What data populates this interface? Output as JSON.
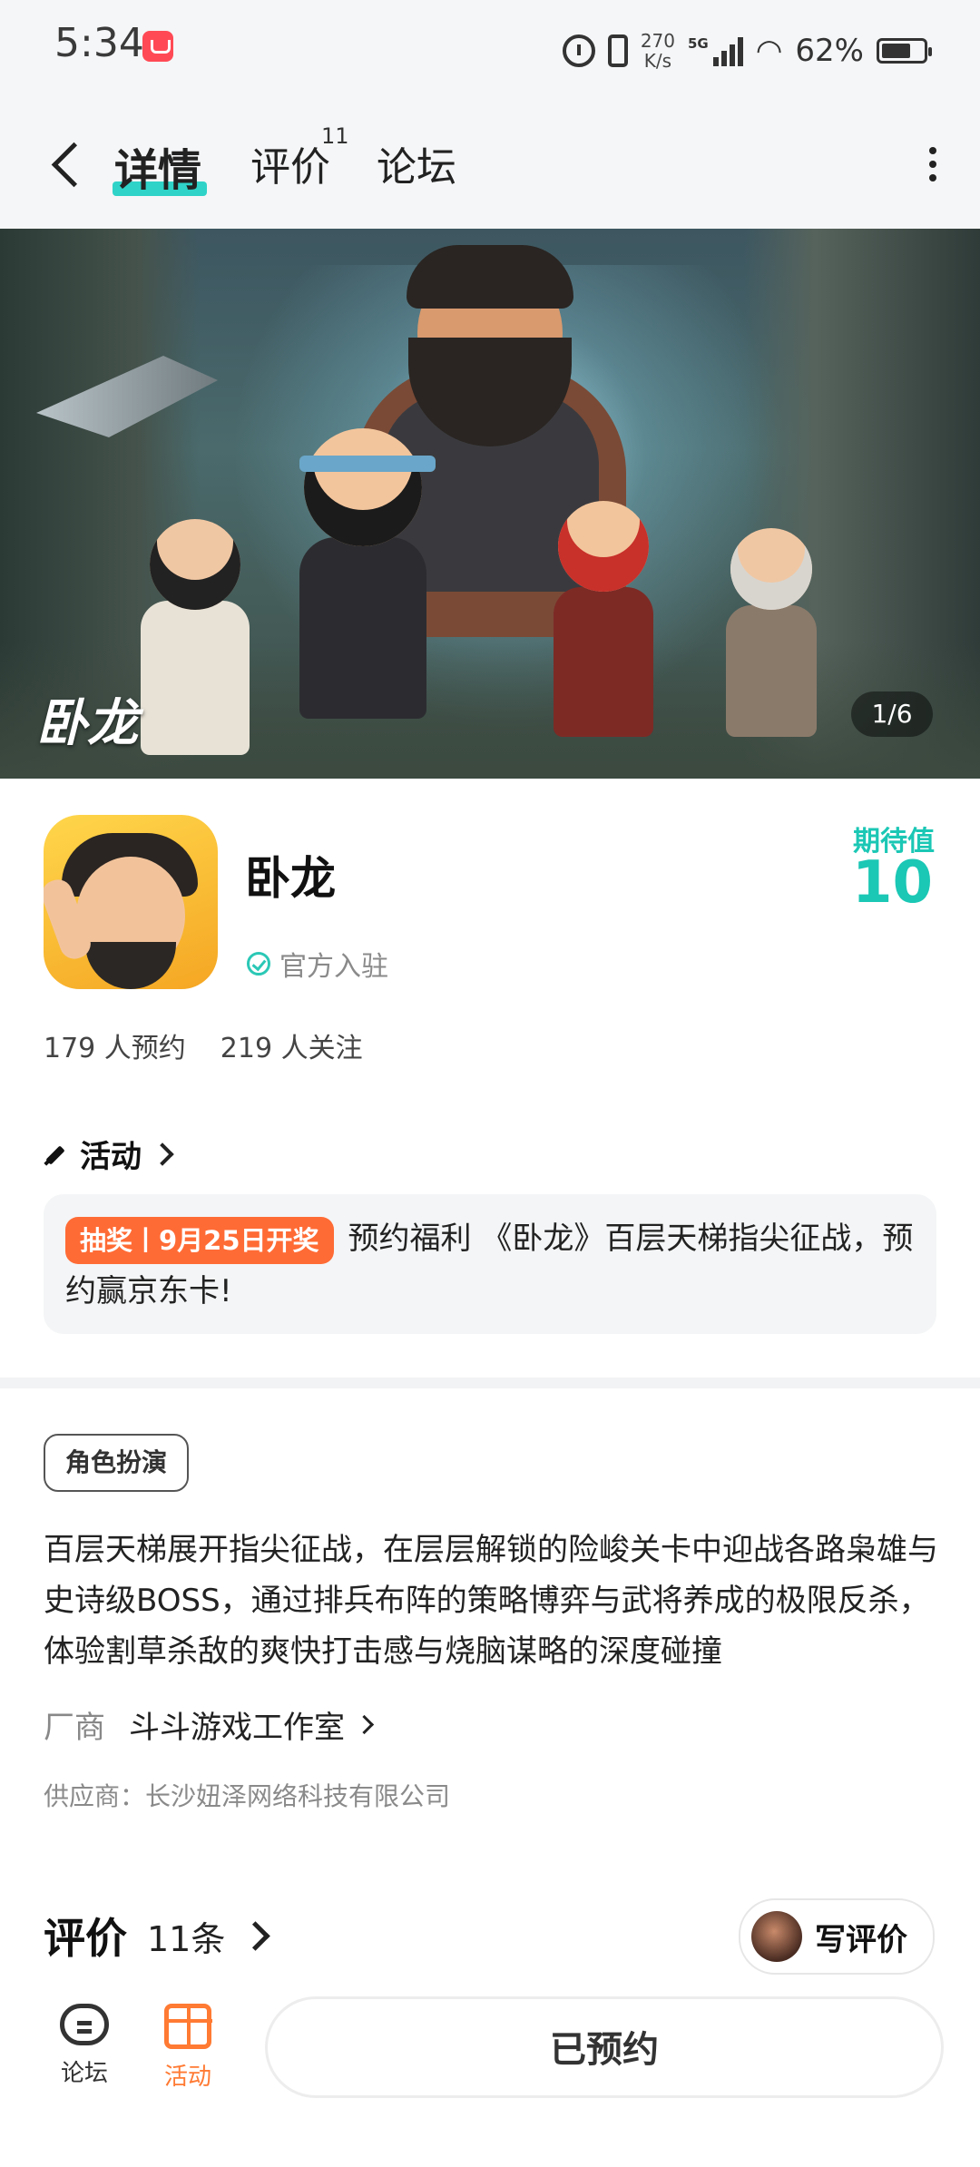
{
  "status_bar": {
    "time": "5:34",
    "net_speed_value": "270",
    "net_speed_unit": "K/s",
    "network": "5G",
    "battery": "62%"
  },
  "nav": {
    "tab_detail": "详情",
    "tab_review": "评价",
    "tab_review_count": "11",
    "tab_forum": "论坛"
  },
  "banner": {
    "logo_text": "卧龙",
    "pager": "1/6"
  },
  "app": {
    "name": "卧龙",
    "verified_label": "官方入驻",
    "expect_label": "期待值",
    "expect_value": "10",
    "stats_reserve": "179 人预约",
    "stats_follow": "219 人关注"
  },
  "activity": {
    "title": "活动",
    "badge": "抽奖丨9月25日开奖",
    "text": "预约福利 《卧龙》百层天梯指尖征战，预约赢京东卡!"
  },
  "details": {
    "tag": "角色扮演",
    "description": "百层天梯展开指尖征战，在层层解锁的险峻关卡中迎战各路枭雄与史诗级BOSS，通过排兵布阵的策略博弈与武将养成的极限反杀，体验割草杀敌的爽快打击感与烧脑谋略的深度碰撞",
    "vendor_label": "厂商",
    "vendor_name": "斗斗游戏工作室",
    "supplier": "供应商：长沙妞泽网络科技有限公司"
  },
  "reviews": {
    "title": "评价",
    "count": "11条",
    "write_label": "写评价"
  },
  "bottom_bar": {
    "forum_label": "论坛",
    "activity_label": "活动",
    "activity_color": "#ff7a33",
    "reserve_button": "已预约"
  },
  "colors": {
    "accent": "#1bc7b5",
    "badge": "#ff6b35"
  }
}
